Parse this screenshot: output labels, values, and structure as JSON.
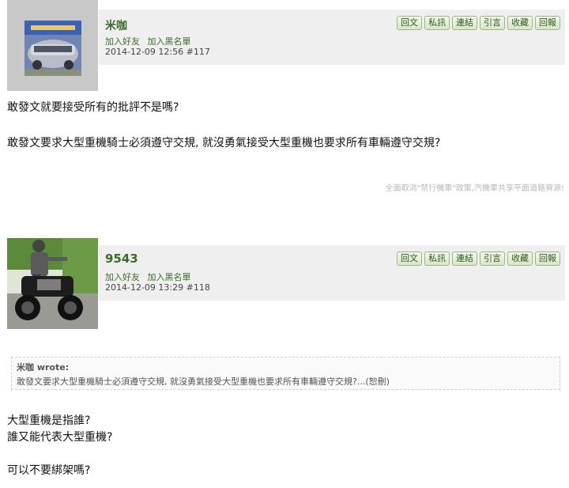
{
  "buttons": [
    "回文",
    "私訊",
    "連結",
    "引言",
    "收藏",
    "回報"
  ],
  "posts": [
    {
      "username": "米咖",
      "add_friend": "加入好友",
      "add_blacklist": "加入黑名單",
      "timestamp": "2014-12-09 12:56",
      "post_number": "#117",
      "avatar_icon": "car-photo",
      "lines": [
        "敢發文就要接受所有的批評不是嗎?",
        "敢發文要求大型重機騎士必須遵守交規, 就沒勇氣接受大型重機也要求所有車輛遵守交規?"
      ],
      "signature": "全面取消\"禁行機車\"政策,汽機車共享平面道路資源!"
    },
    {
      "username": "9543",
      "add_friend": "加入好友",
      "add_blacklist": "加入黑名單",
      "timestamp": "2014-12-09 13:29",
      "post_number": "#118",
      "avatar_icon": "motorcycle-rider-photo",
      "quote": {
        "author": "米咖 wrote:",
        "text": "敢發文要求大型重機騎士必須遵守交規, 就沒勇氣接受大型重機也要求所有車輛遵守交規?...(恕刪)"
      },
      "lines": [
        "大型重機是指誰?",
        "誰又能代表大型重機?",
        "可以不要綁架嗎?"
      ]
    }
  ]
}
